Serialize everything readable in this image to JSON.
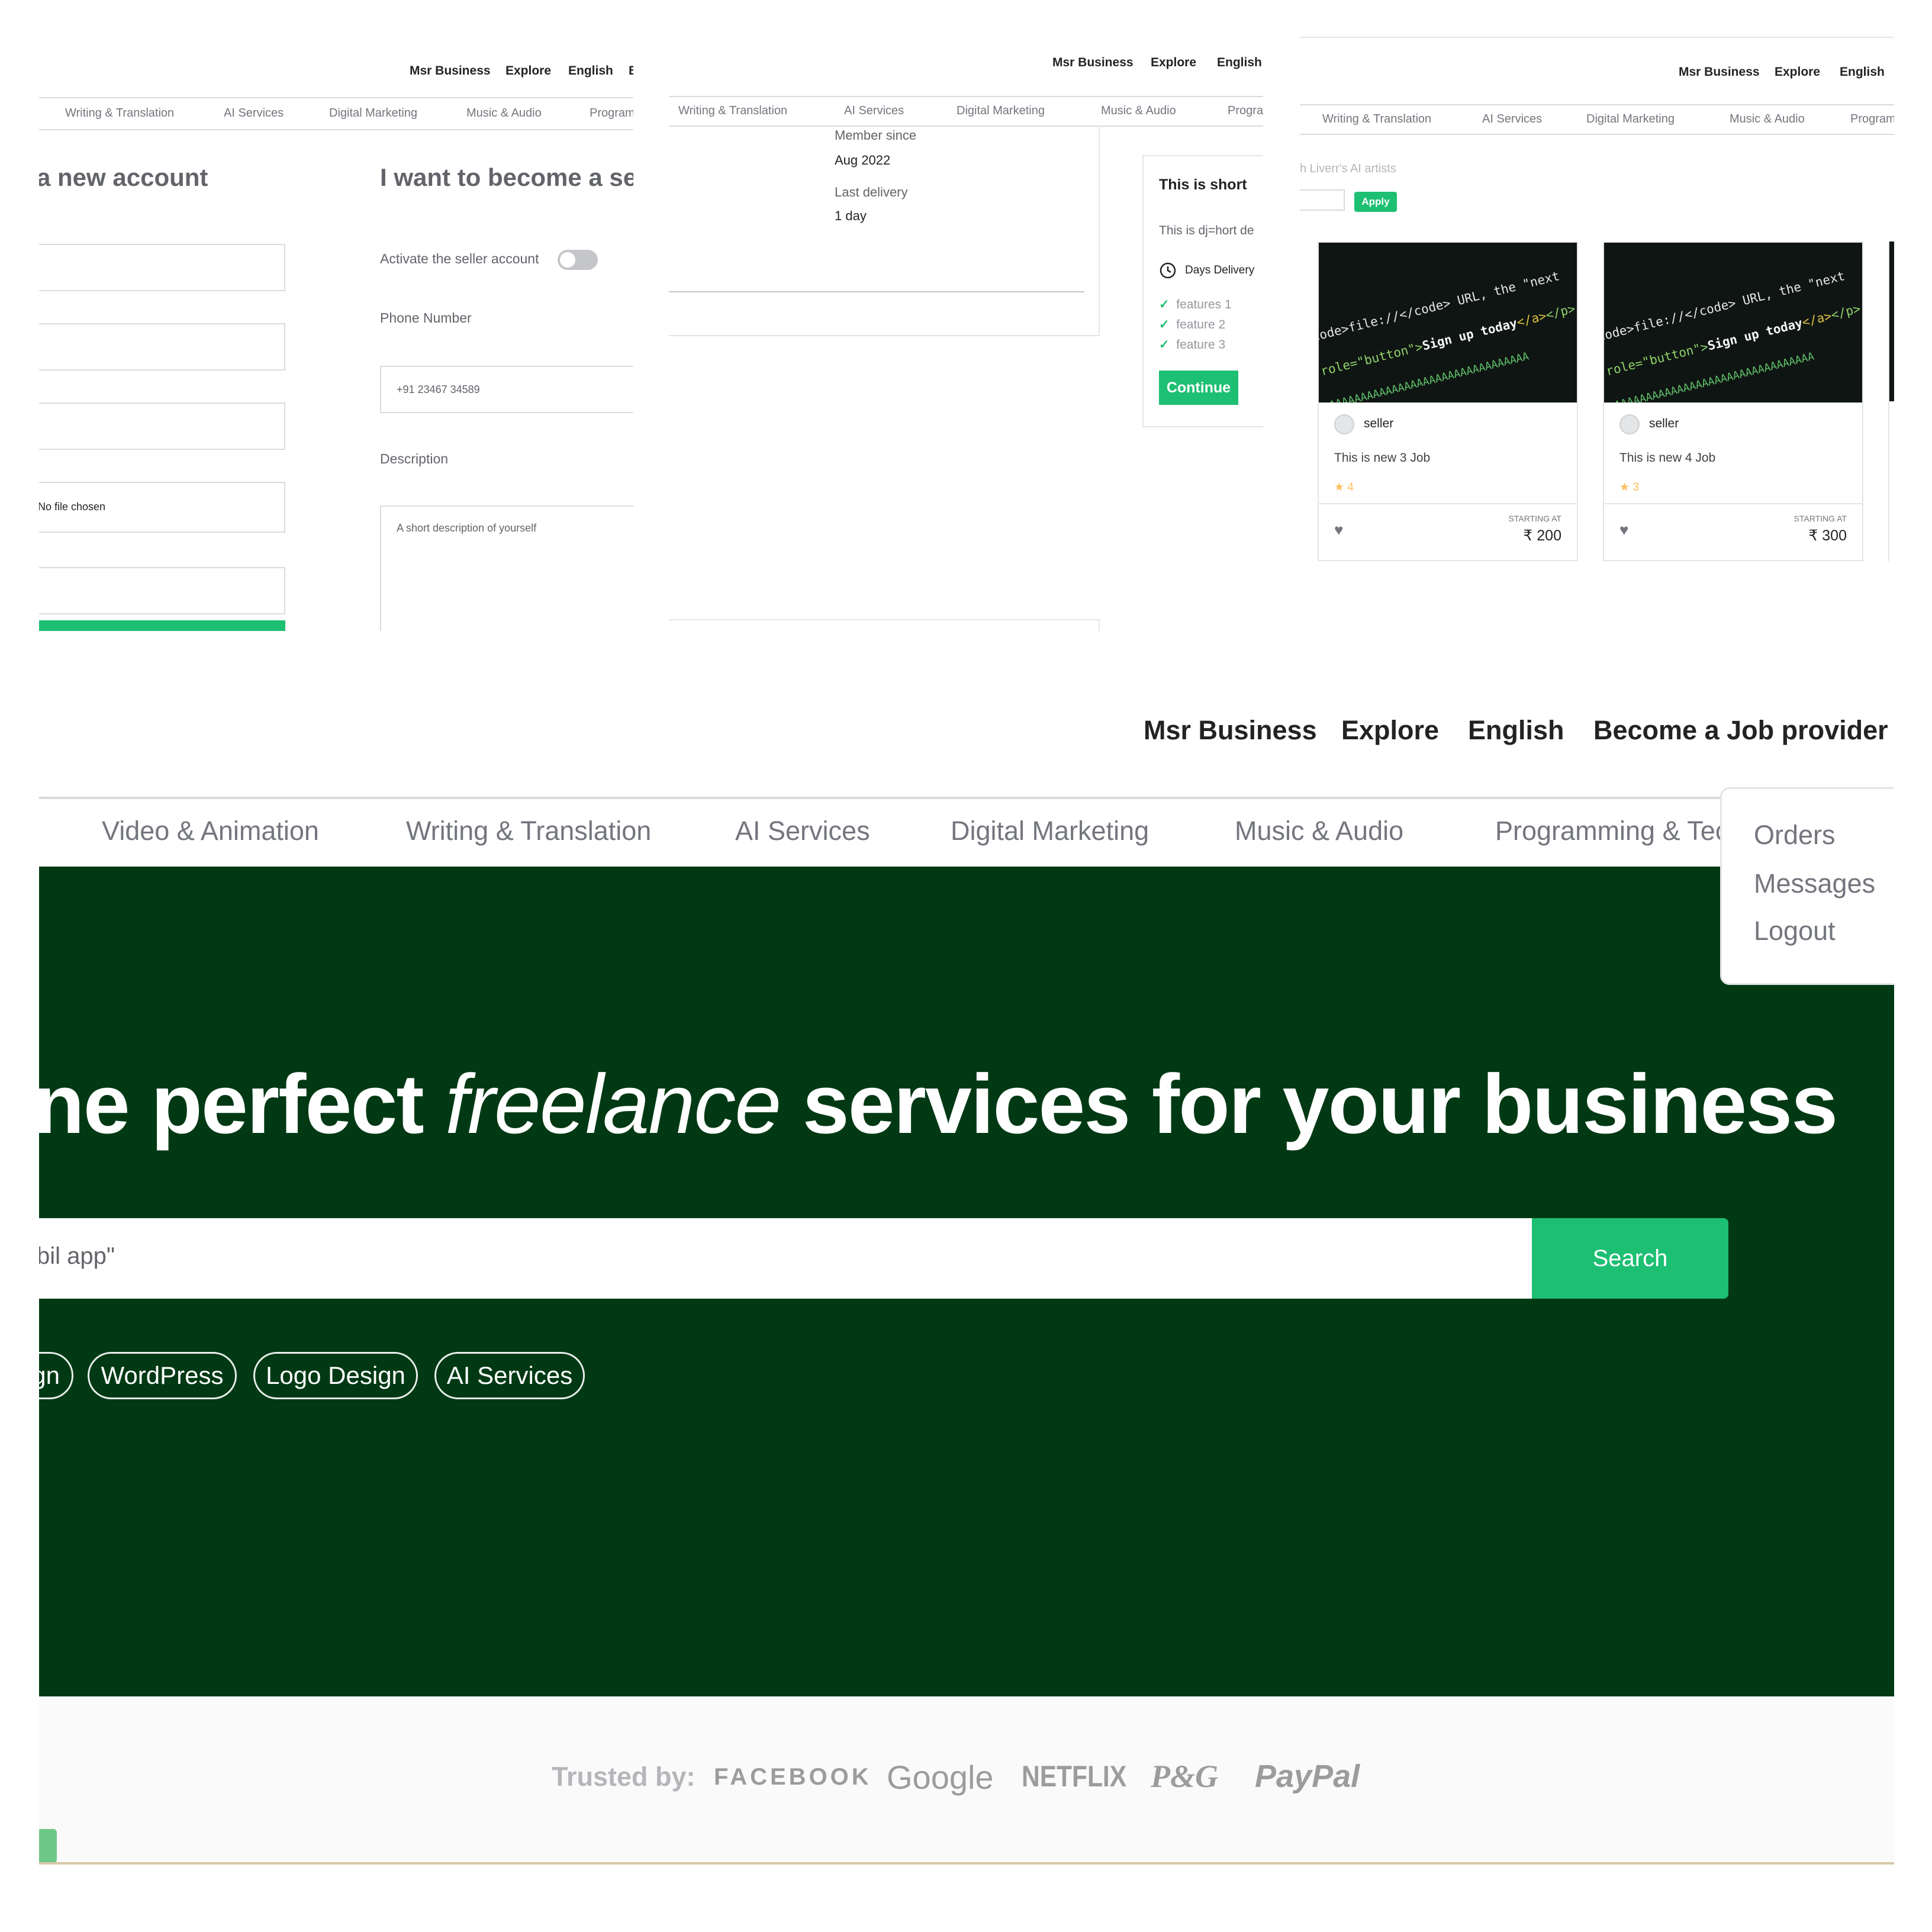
{
  "nav": {
    "business": "Msr Business",
    "explore": "Explore",
    "language": "English",
    "become_provider": "Become a Job provider"
  },
  "categories": {
    "video": "Video & Animation",
    "writing": "Writing & Translation",
    "ai": "AI Services",
    "marketing": "Digital Marketing",
    "music": "Music & Audio",
    "programming": "Programming & Tech"
  },
  "signup": {
    "title": "a new account",
    "file_status": "No file chosen",
    "seller_title": "I want to become a seller",
    "activate_label": "Activate the seller account",
    "phone_label": "Phone Number",
    "phone_value": "+91 23467 34589",
    "description_label": "Description",
    "description_placeholder": "A short description of yourself"
  },
  "gig_detail": {
    "member_since_label": "Member since",
    "member_since_value": "Aug 2022",
    "last_delivery_label": "Last delivery",
    "last_delivery_value": "1 day",
    "package_title": "This is short",
    "package_desc": "This is dj=hort de",
    "delivery": "Days Delivery",
    "features": [
      "features 1",
      "feature 2",
      "feature 3"
    ],
    "continue": "Continue"
  },
  "listing": {
    "subtitle": "h Liverr's AI artists",
    "apply": "Apply",
    "cards": [
      {
        "seller": "seller",
        "title": "This is new 3 Job",
        "rating": "4",
        "starting_at": "STARTING AT",
        "price": "₹ 200"
      },
      {
        "seller": "seller",
        "title": "This is new 4 Job",
        "rating": "3",
        "starting_at": "STARTING AT",
        "price": "₹ 300"
      }
    ]
  },
  "dropdown": {
    "items": [
      "Orders",
      "Messages",
      "Logout"
    ]
  },
  "hero": {
    "title_start": "ne perfect ",
    "title_italic": "freelance",
    "title_end": " services for your business",
    "search_value": "bil app\"",
    "search_button": "Search",
    "popular": [
      "gn",
      "WordPress",
      "Logo Design",
      "AI Services"
    ]
  },
  "trusted": {
    "label": "Trusted by:",
    "brands": [
      "FACEBOOK",
      "Google",
      "NETFLIX",
      "P&G",
      "PayPal"
    ]
  },
  "colors": {
    "brand_green": "#1dbf73",
    "hero_bg": "#013914",
    "star": "#ffbe5b"
  }
}
